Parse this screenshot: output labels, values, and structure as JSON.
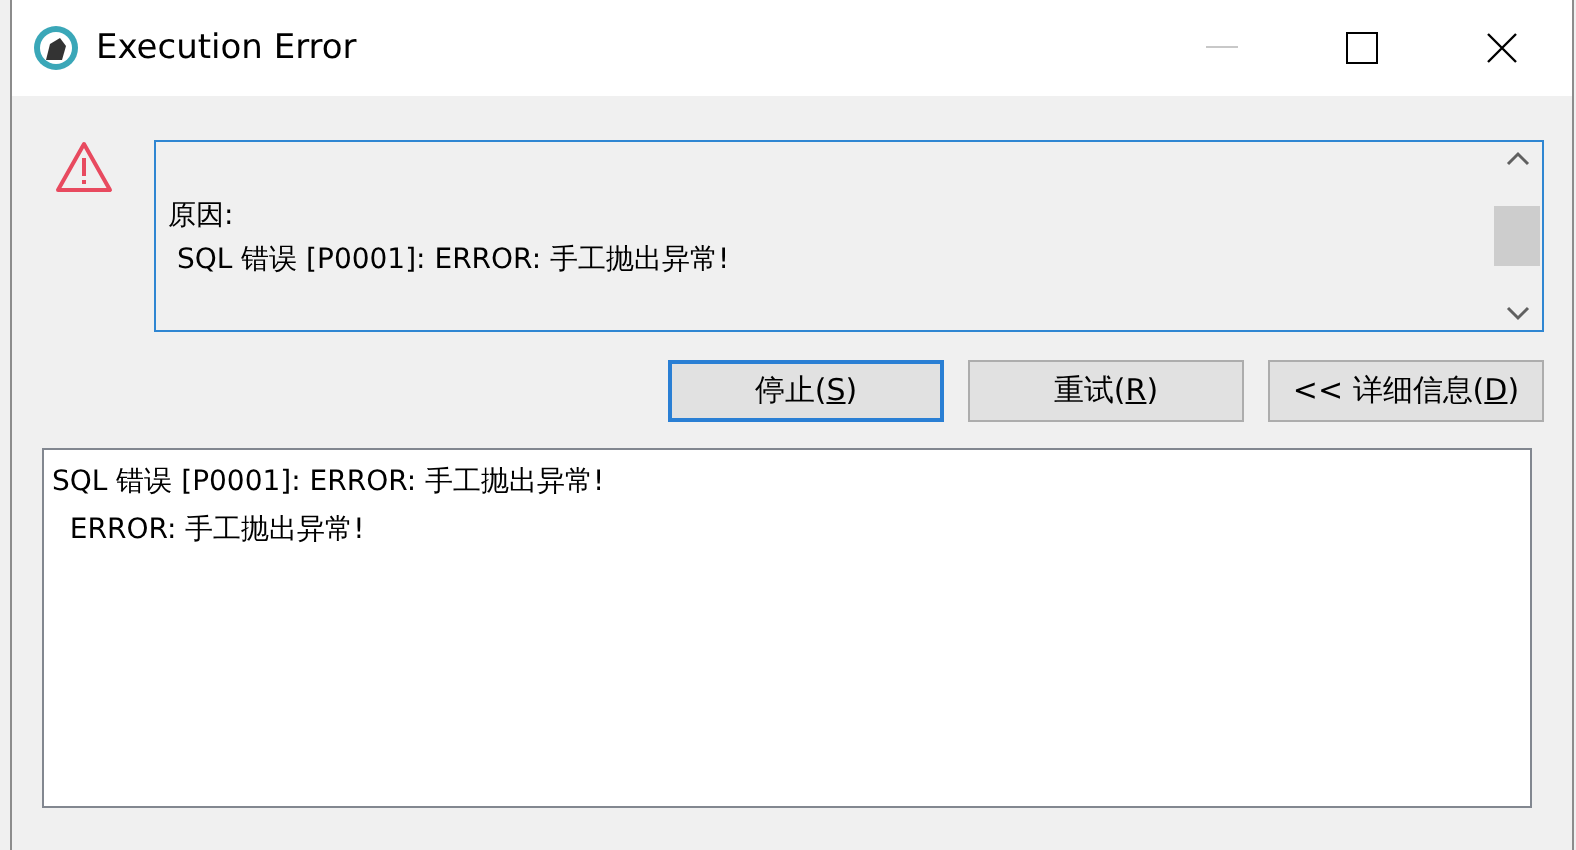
{
  "window": {
    "title": "Execution Error",
    "minimize_disabled": true
  },
  "message": {
    "lines": [
      "原因:",
      " SQL 错误 [P0001]: ERROR: 手工抛出异常!"
    ]
  },
  "buttons": [
    {
      "before": "停止(",
      "mnemonic": "S",
      "after": ")",
      "default": true
    },
    {
      "before": "重试(",
      "mnemonic": "R",
      "after": ")",
      "default": false
    },
    {
      "before": "<< 详细信息(",
      "mnemonic": "D",
      "after": ")",
      "default": false
    }
  ],
  "details": {
    "lines": [
      "SQL 错误 [P0001]: ERROR: 手工抛出异常!",
      "  ERROR: 手工抛出异常!"
    ]
  }
}
